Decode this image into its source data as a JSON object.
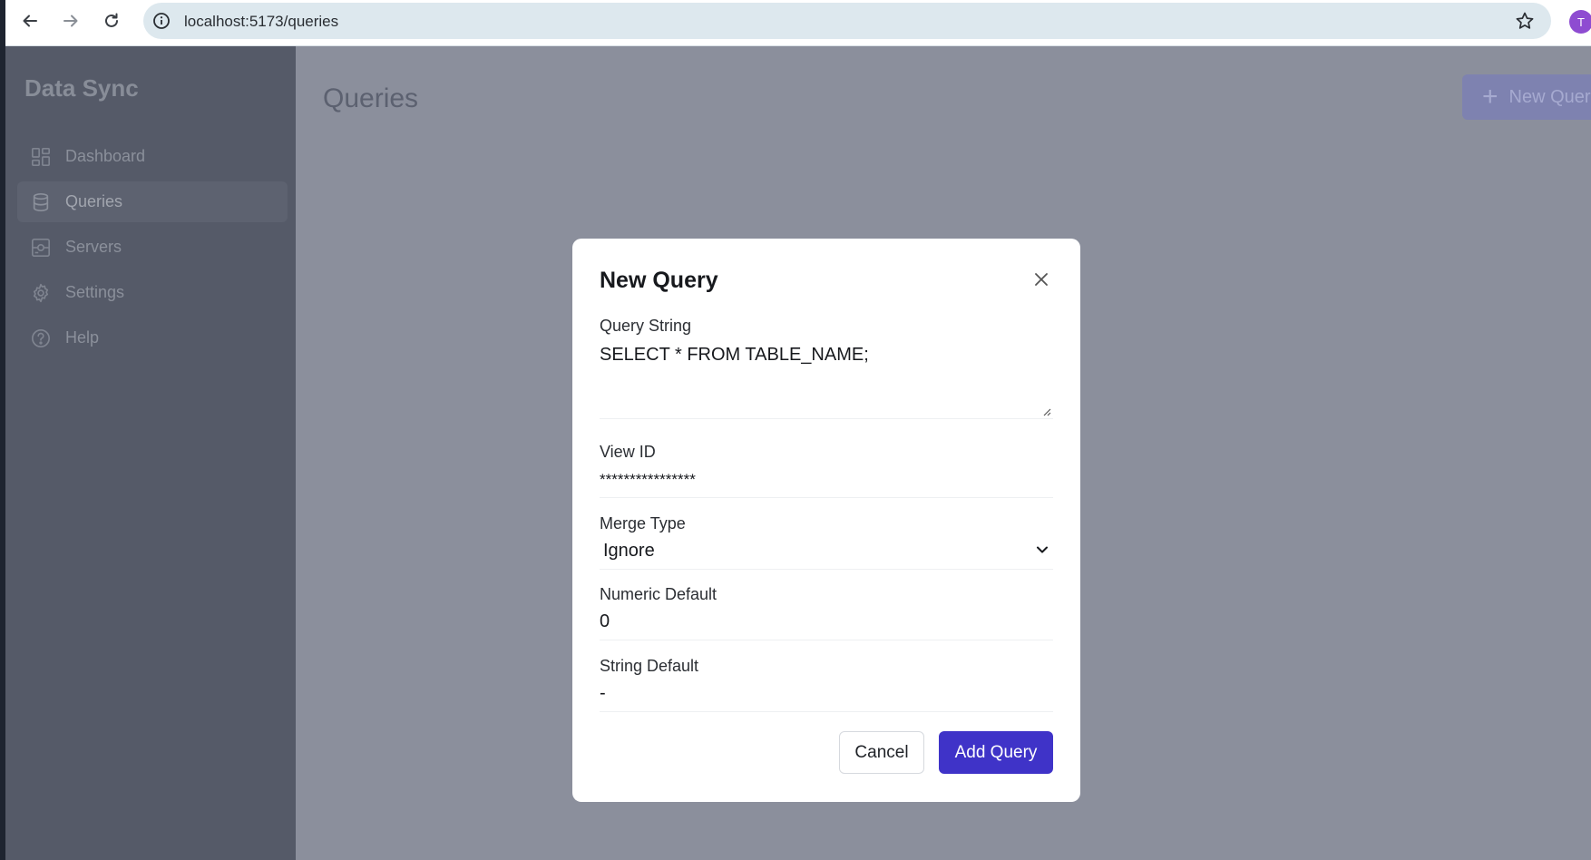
{
  "browser": {
    "url": "localhost:5173/queries",
    "avatar_initial": "T"
  },
  "sidebar": {
    "brand": "Data Sync",
    "items": [
      {
        "label": "Dashboard",
        "icon": "dashboard-icon",
        "active": false
      },
      {
        "label": "Queries",
        "icon": "database-icon",
        "active": true
      },
      {
        "label": "Servers",
        "icon": "server-icon",
        "active": false
      },
      {
        "label": "Settings",
        "icon": "gear-icon",
        "active": false
      },
      {
        "label": "Help",
        "icon": "help-icon",
        "active": false
      }
    ]
  },
  "main": {
    "title": "Queries",
    "new_button_label": "New Quer"
  },
  "modal": {
    "title": "New Query",
    "fields": {
      "query_string": {
        "label": "Query String",
        "value": "SELECT * FROM TABLE_NAME;"
      },
      "view_id": {
        "label": "View ID",
        "value": "****************"
      },
      "merge_type": {
        "label": "Merge Type",
        "value": "Ignore"
      },
      "numeric_default": {
        "label": "Numeric Default",
        "value": "0"
      },
      "string_default": {
        "label": "String Default",
        "value": "-"
      }
    },
    "cancel_label": "Cancel",
    "submit_label": "Add Query"
  },
  "colors": {
    "primary": "#3f33c8",
    "overlay": "#8b8f9c",
    "sidebar": "#555a68"
  }
}
